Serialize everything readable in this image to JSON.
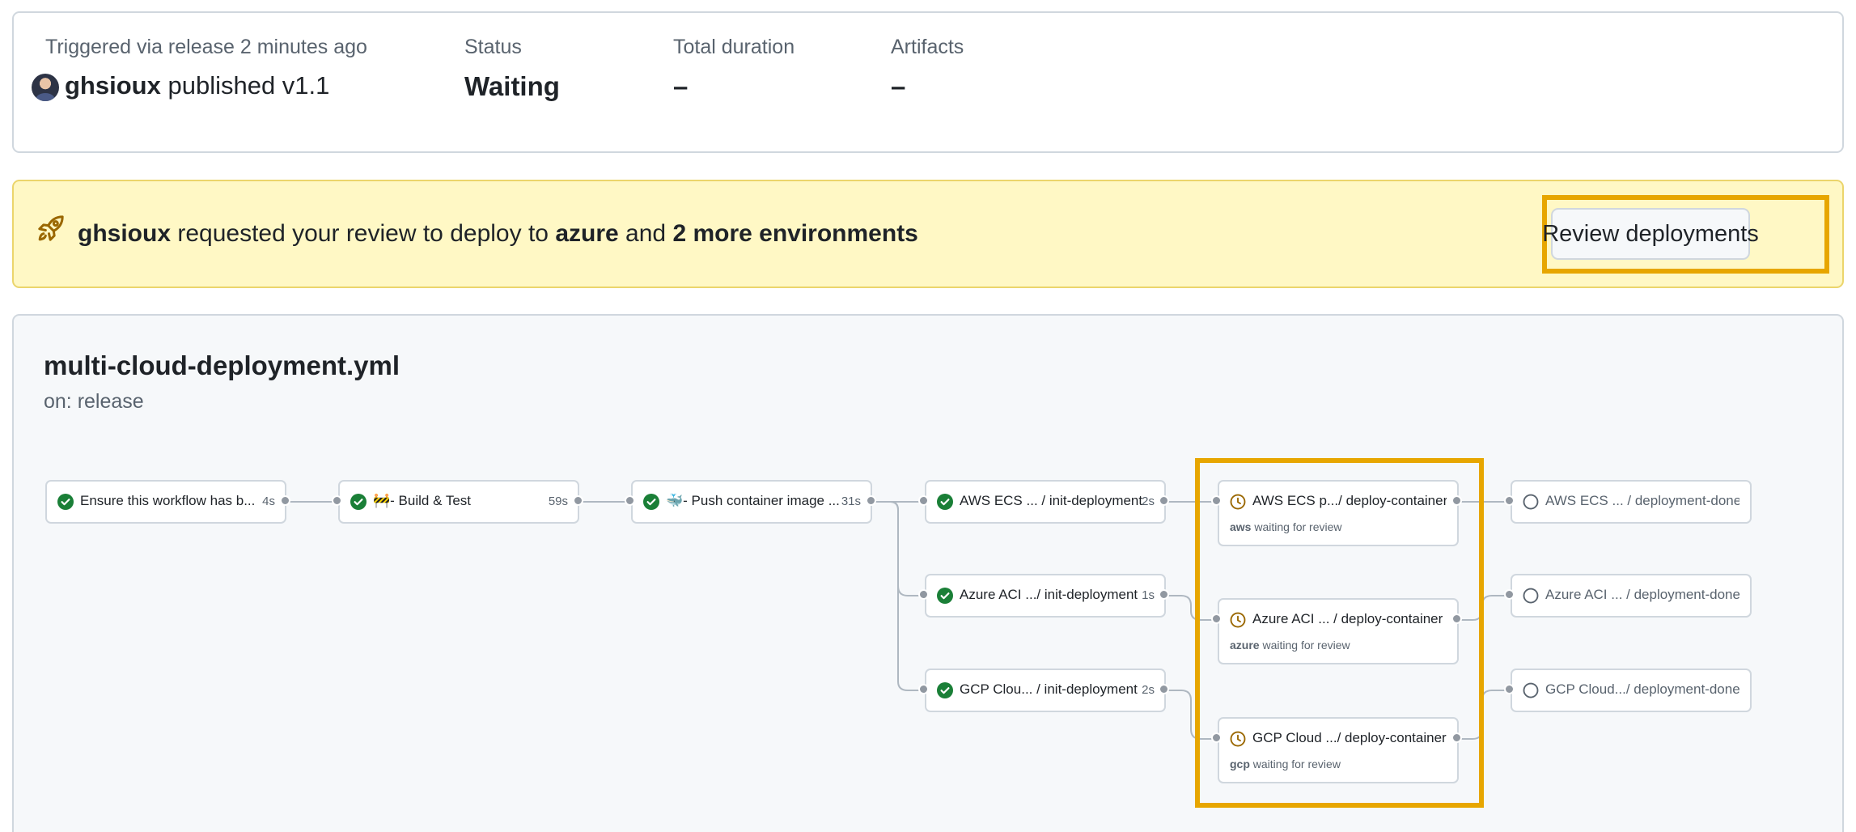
{
  "summary": {
    "trigger_label": "Triggered via release 2 minutes ago",
    "actor": "ghsioux",
    "action": "published v1.1",
    "status_label": "Status",
    "status_value": "Waiting",
    "duration_label": "Total duration",
    "duration_value": "–",
    "artifacts_label": "Artifacts",
    "artifacts_value": "–"
  },
  "banner": {
    "actor": "ghsioux",
    "text_1": "requested your review to deploy to",
    "environment": "azure",
    "text_2": "and",
    "more": "2 more environments",
    "button_label": "Review deployments",
    "highlight_color": "#e7a600"
  },
  "workflow": {
    "file": "multi-cloud-deployment.yml",
    "trigger": "on: release",
    "jobs": [
      {
        "name": "Ensure this workflow has b...",
        "duration": "4s",
        "status": "success"
      },
      {
        "name": "🚧- Build & Test",
        "duration": "59s",
        "status": "success"
      },
      {
        "name": "🐳- Push container image ...",
        "duration": "31s",
        "status": "success"
      },
      {
        "name": "AWS ECS ... / init-deployment",
        "duration": "2s",
        "status": "success"
      },
      {
        "name": "Azure ACI .../ init-deployment",
        "duration": "1s",
        "status": "success"
      },
      {
        "name": "GCP Clou... / init-deployment",
        "duration": "2s",
        "status": "success"
      },
      {
        "name": "AWS ECS p.../ deploy-container",
        "environment": "aws",
        "note": "waiting for review",
        "status": "waiting"
      },
      {
        "name": "Azure ACI ...  / deploy-container",
        "environment": "azure",
        "note": "waiting for review",
        "status": "waiting"
      },
      {
        "name": "GCP Cloud .../ deploy-container",
        "environment": "gcp",
        "note": "waiting for review",
        "status": "waiting"
      },
      {
        "name": "AWS ECS ...  / deployment-done",
        "status": "pending"
      },
      {
        "name": "Azure ACI ... / deployment-done",
        "status": "pending"
      },
      {
        "name": "GCP Cloud.../ deployment-done",
        "status": "pending"
      }
    ]
  },
  "colors": {
    "success": "#1a7f37",
    "waiting": "#9a6700",
    "pending": "#59636e",
    "banner_bg": "#fff8c5"
  },
  "icons": {
    "success": "check-circle-fill-icon",
    "waiting": "clock-icon",
    "pending": "circle-outline-icon",
    "banner": "rocket-icon"
  }
}
